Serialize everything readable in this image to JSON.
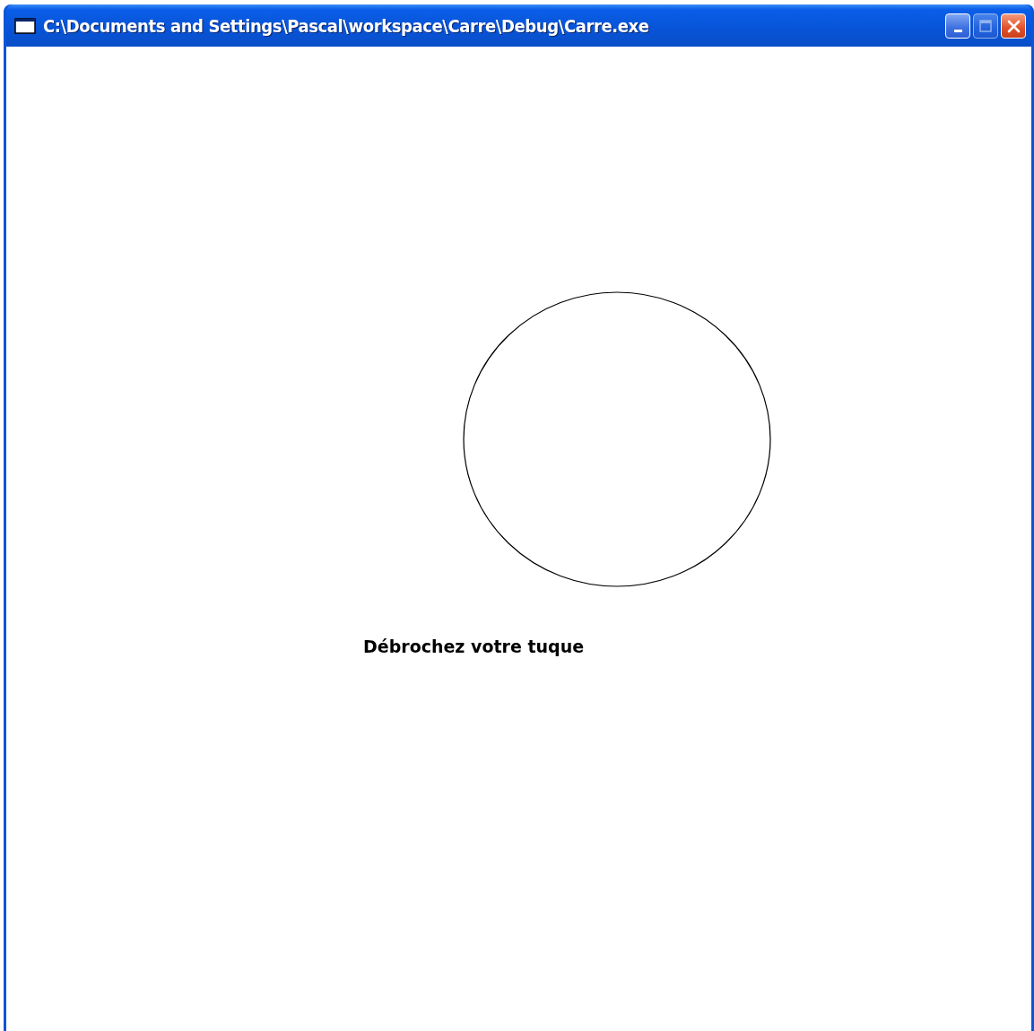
{
  "window": {
    "title": "C:\\Documents and Settings\\Pascal\\workspace\\Carre\\Debug\\Carre.exe"
  },
  "title_buttons": [
    {
      "kind": "minimize",
      "disabled": false
    },
    {
      "kind": "maximize",
      "disabled": true
    },
    {
      "kind": "close",
      "disabled": false
    }
  ],
  "canvas": {
    "message": "Débrochez votre tuque"
  }
}
